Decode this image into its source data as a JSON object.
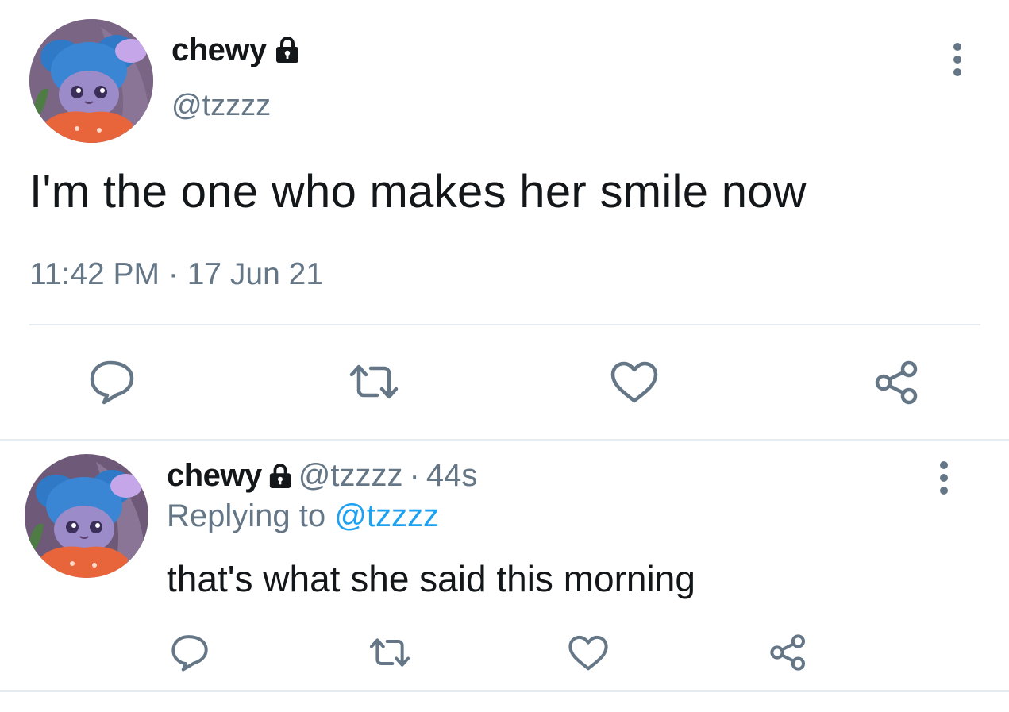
{
  "main_tweet": {
    "display_name": "chewy",
    "handle": "@tzzzz",
    "text": "I'm the one who makes her smile now",
    "timestamp": "11:42 PM · 17 Jun 21",
    "protected_icon": "lock-icon",
    "actions": [
      "reply-icon",
      "retweet-icon",
      "like-icon",
      "share-icon"
    ]
  },
  "reply_tweet": {
    "display_name": "chewy",
    "handle": "@tzzzz",
    "separator": "·",
    "time": "44s",
    "replying_prefix": "Replying to",
    "replying_to": "@tzzzz",
    "text": "that's what she said this morning",
    "protected_icon": "lock-icon",
    "actions": [
      "reply-icon",
      "retweet-icon",
      "like-icon",
      "share-icon"
    ]
  },
  "colors": {
    "primary_text": "#14171a",
    "secondary_text": "#657786",
    "link": "#1da1f2",
    "divider": "#e6ecf0",
    "icon": "#657786"
  }
}
